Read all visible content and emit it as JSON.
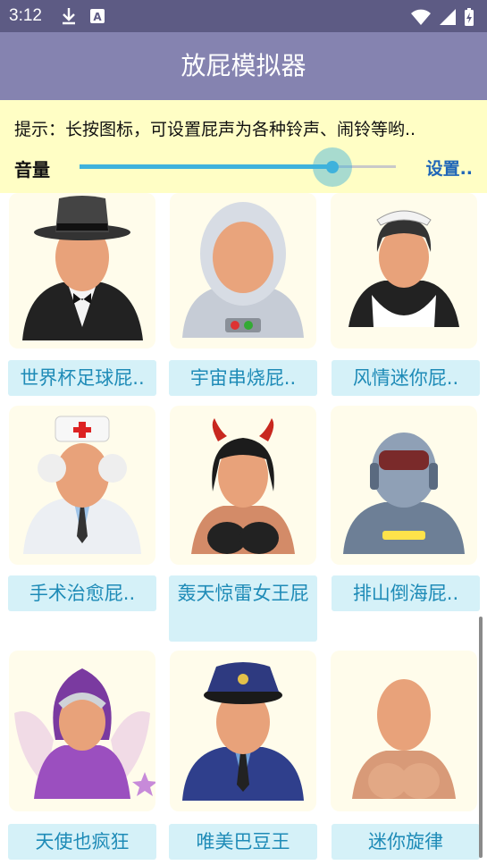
{
  "status": {
    "time": "3:12"
  },
  "app": {
    "title": "放屁模拟器"
  },
  "tip": {
    "text": "提示：长按图标，可设置屁声为各种铃声、闹铃等哟.."
  },
  "volume": {
    "label": "音量",
    "level_percent": 80,
    "settings": "设置.."
  },
  "sounds": [
    {
      "label": "世界杯足球屁..",
      "icon": "gentleman-top-hat-icon"
    },
    {
      "label": "宇宙串烧屁..",
      "icon": "astronaut-icon"
    },
    {
      "label": "风情迷你屁..",
      "icon": "maid-icon"
    },
    {
      "label": "手术治愈屁..",
      "icon": "doctor-icon"
    },
    {
      "label": "轰天惊雷女王屁",
      "icon": "devil-woman-icon"
    },
    {
      "label": "排山倒海屁..",
      "icon": "robot-icon"
    },
    {
      "label": "天使也疯狂",
      "icon": "fairy-angel-icon"
    },
    {
      "label": "唯美巴豆王",
      "icon": "police-officer-icon"
    },
    {
      "label": "迷你旋律",
      "icon": "nude-figure-icon"
    }
  ],
  "colors": {
    "status_bar": "#5d5b84",
    "app_bar": "#8583b0",
    "tip_bg": "#fffec5",
    "accent": "#3fb2dc",
    "label_bg": "#d5f1f8",
    "label_text": "#1e8bb7"
  }
}
